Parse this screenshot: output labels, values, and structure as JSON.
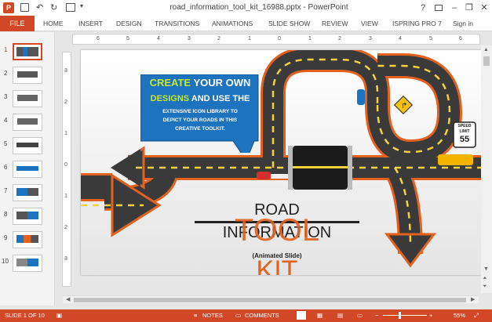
{
  "window": {
    "title": "road_information_tool_kit_16988.pptx - PowerPoint",
    "controls": {
      "help": "?",
      "minimize": "–",
      "restore": "❐",
      "close": "✕"
    }
  },
  "quick_access": {
    "undo": "↶",
    "redo": "↻"
  },
  "ribbon": {
    "file_tab": "FILE",
    "tabs": [
      "HOME",
      "INSERT",
      "DESIGN",
      "TRANSITIONS",
      "ANIMATIONS",
      "SLIDE SHOW",
      "REVIEW",
      "VIEW",
      "ISPRING PRO 7"
    ],
    "sign_in": "Sign in"
  },
  "thumbnails": {
    "selected": 1,
    "items": [
      "1",
      "2",
      "3",
      "4",
      "5",
      "6",
      "7",
      "8",
      "9",
      "10"
    ]
  },
  "ruler": {
    "h_labels": [
      "6",
      "5",
      "4",
      "3",
      "2",
      "1",
      "0",
      "1",
      "2",
      "3",
      "4",
      "5",
      "6"
    ],
    "v_labels": [
      "3",
      "2",
      "1",
      "0",
      "1",
      "2",
      "3"
    ]
  },
  "slide": {
    "callout": {
      "line1_a": "CREATE",
      "line1_b": " YOUR OWN",
      "line2_a": "DESIGNS",
      "line2_b": " AND USE THE",
      "line3": "EXTENSIVE ICON LIBRARY TO",
      "line4": "DEPICT YOUR ROADS IN THIS",
      "line5": "CREATIVE TOOLKIT."
    },
    "title_road": "ROAD",
    "title_information": "INFORMATION",
    "title_tool": "TOOL",
    "subtitle": "(Animated Slide)",
    "title_kit": "KIT",
    "speed_sign": {
      "top": "SPEED",
      "mid": "LIMIT",
      "value": "55"
    }
  },
  "status_bar": {
    "slide_info": "SLIDE 1 OF 10",
    "notes": "NOTES",
    "comments": "COMMENTS",
    "zoom": "55%"
  },
  "colors": {
    "accent": "#d24726",
    "road": "#3a3a3a",
    "road_edge": "#e2611f",
    "callout": "#1e73be",
    "highlight": "#c6e62e"
  }
}
